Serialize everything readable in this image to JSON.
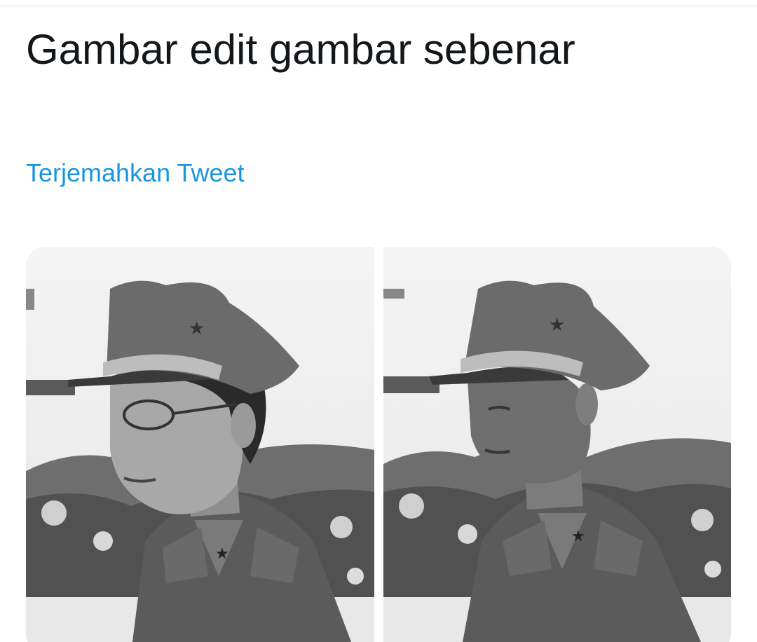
{
  "tweet": {
    "text": "Gambar edit gambar sebenar",
    "translate_label": "Terjemahkan Tweet"
  },
  "media": [
    {
      "alt": "edited photo"
    },
    {
      "alt": "original photo"
    }
  ],
  "colors": {
    "text": "#14171a",
    "link": "#1b95e0",
    "divider": "#d9e8ea"
  }
}
